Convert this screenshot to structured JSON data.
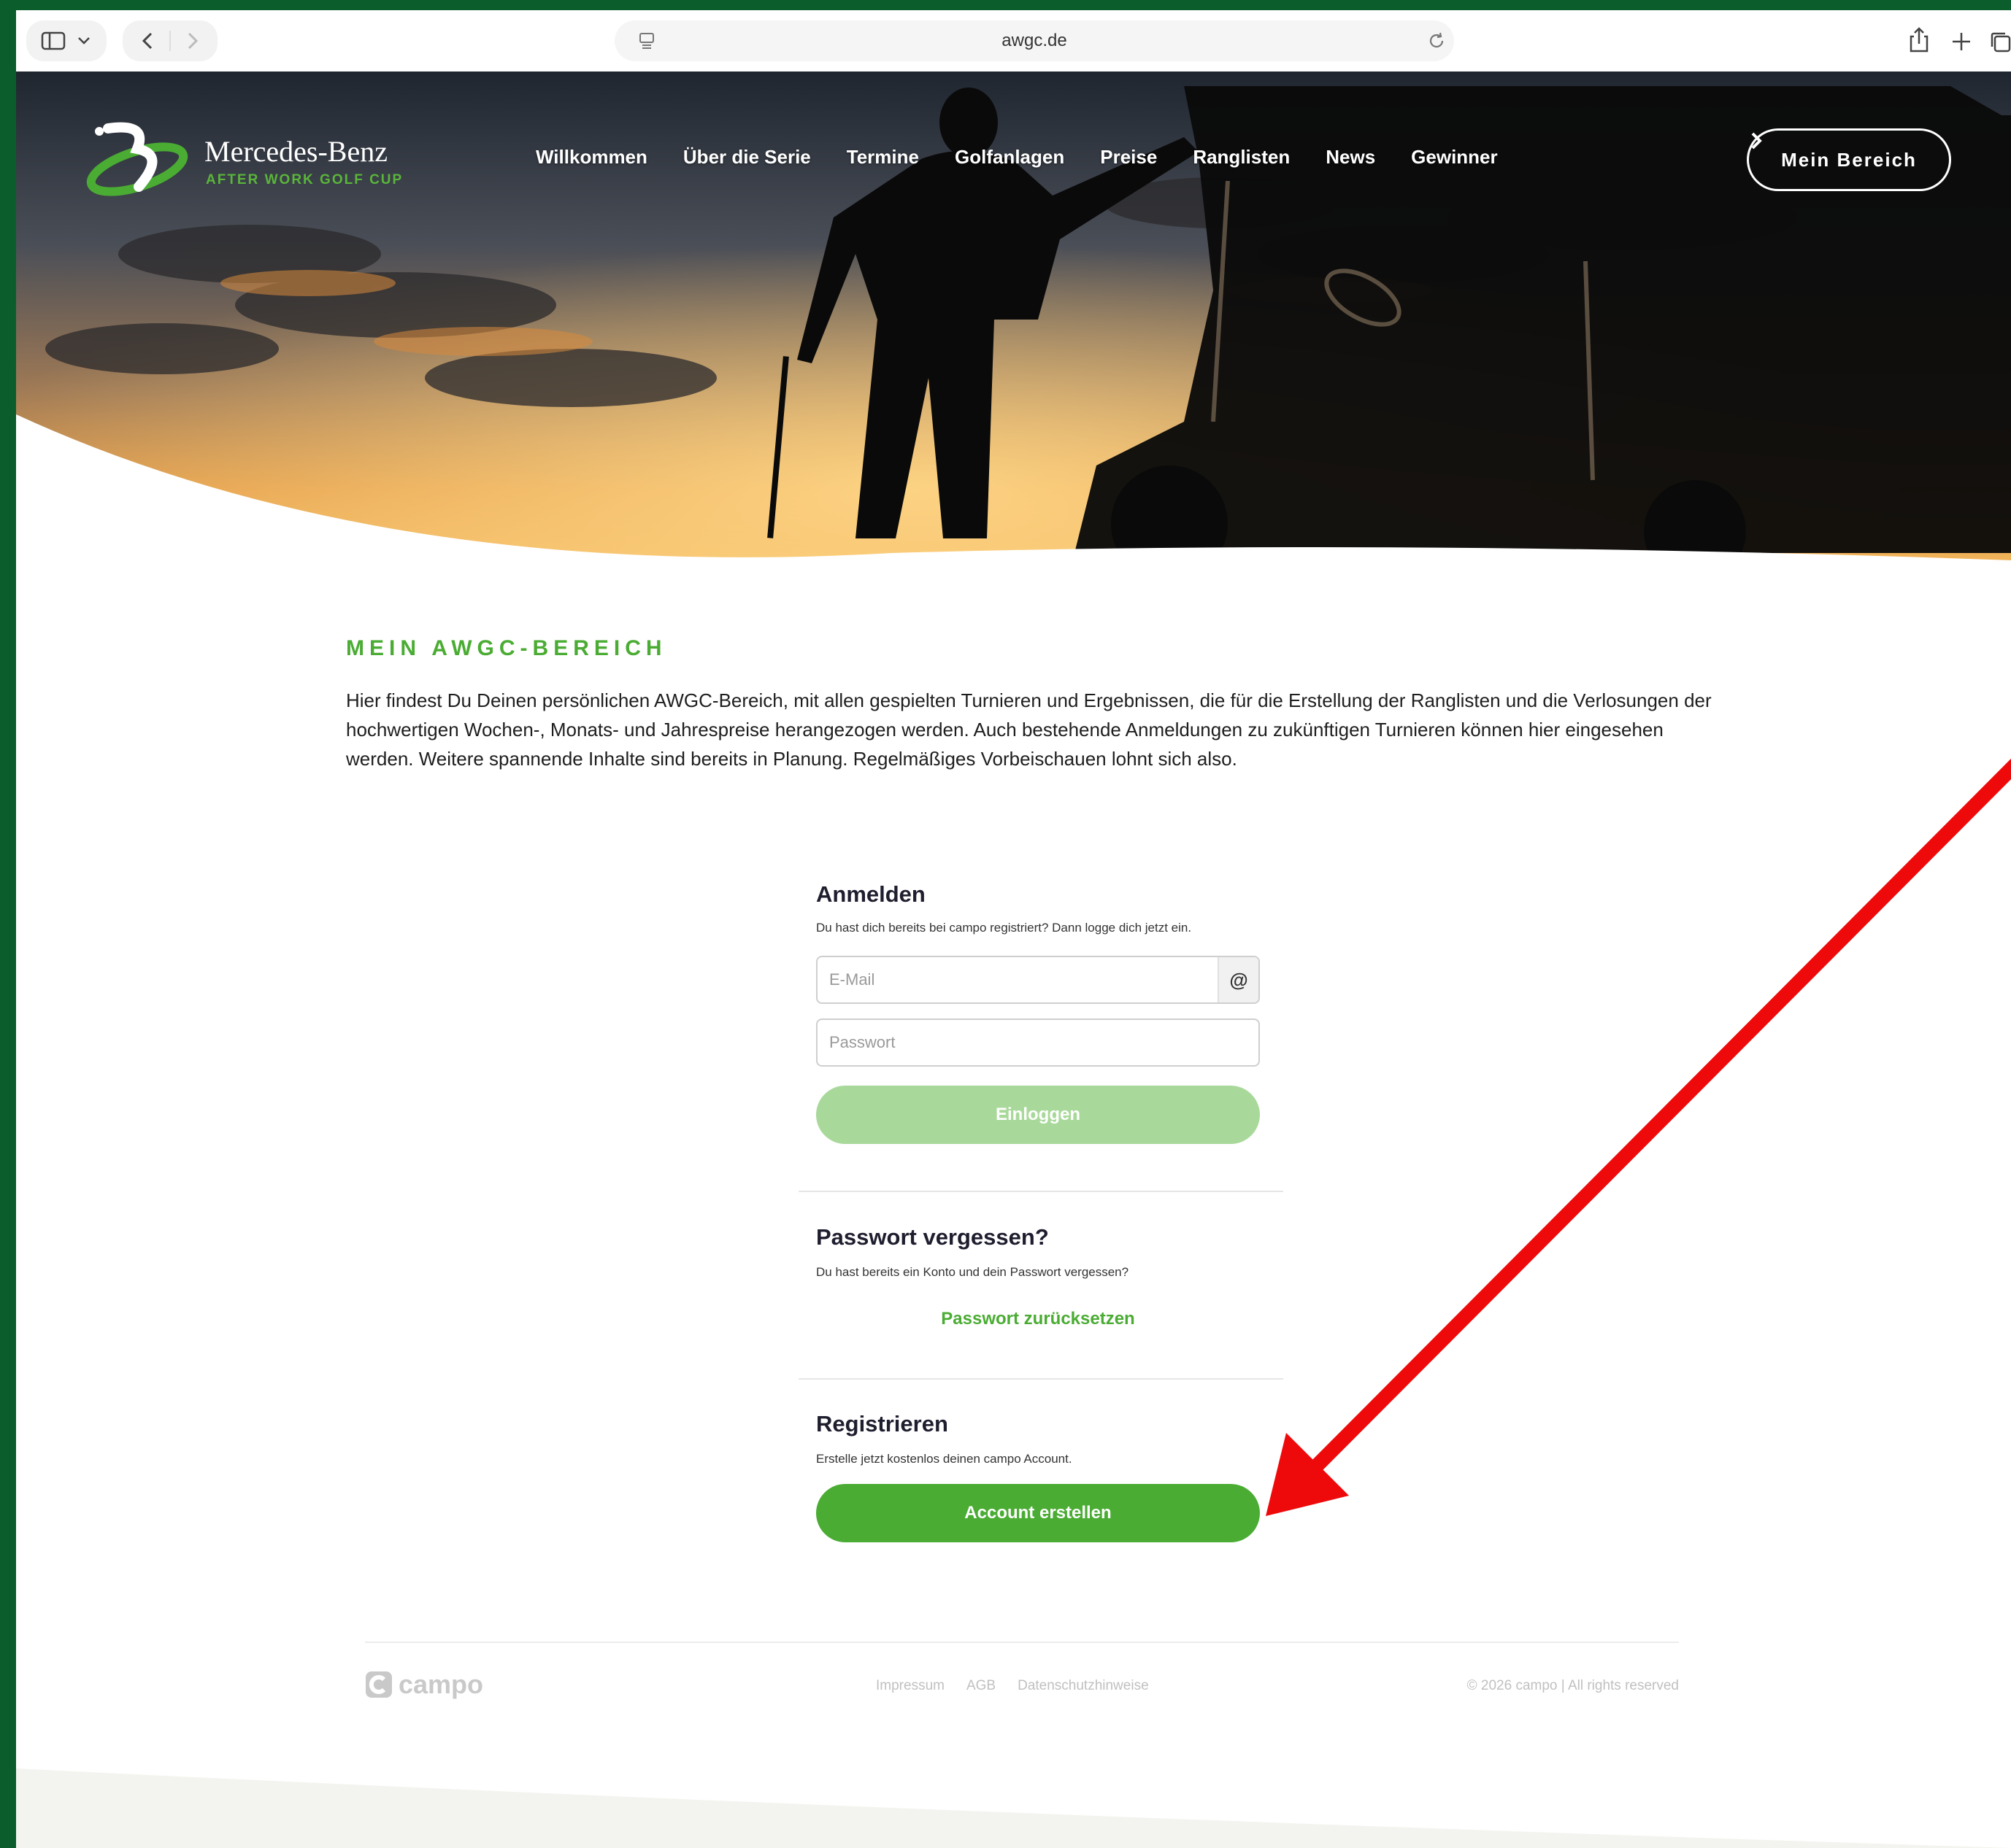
{
  "browser": {
    "url": "awgc.de"
  },
  "header": {
    "logo": {
      "title": "Mercedes-Benz",
      "subtitle": "AFTER WORK GOLF CUP"
    },
    "nav": [
      {
        "label": "Willkommen"
      },
      {
        "label": "Über die Serie"
      },
      {
        "label": "Termine"
      },
      {
        "label": "Golfanlagen"
      },
      {
        "label": "Preise"
      },
      {
        "label": "Ranglisten"
      },
      {
        "label": "News"
      },
      {
        "label": "Gewinner"
      }
    ],
    "account_button": "Mein Bereich"
  },
  "main": {
    "section_title": "MEIN AWGC-BEREICH",
    "intro": "Hier findest Du Deinen persönlichen AWGC-Bereich, mit allen gespielten Turnieren und Ergebnissen, die für die Erstellung der Ranglisten und die Verlosungen der hochwertigen Wochen-, Monats- und Jahrespreise herangezogen werden. Auch bestehende Anmeldungen zu zukünftigen Turnieren können hier eingesehen werden. Weitere spannende Inhalte sind bereits in Planung. Regelmäßiges Vorbeischauen lohnt sich also.",
    "login": {
      "title": "Anmelden",
      "subtitle": "Du hast dich bereits bei campo registriert? Dann logge dich jetzt ein.",
      "email_placeholder": "E-Mail",
      "email_icon": "@",
      "password_placeholder": "Passwort",
      "submit_label": "Einloggen"
    },
    "forgot": {
      "title": "Passwort vergessen?",
      "subtitle": "Du hast bereits ein Konto und dein Passwort vergessen?",
      "link_label": "Passwort zurücksetzen"
    },
    "register": {
      "title": "Registrieren",
      "subtitle": "Erstelle jetzt kostenlos deinen campo Account.",
      "button_label": "Account erstellen"
    }
  },
  "footer": {
    "logo_text": "campo",
    "links": [
      {
        "label": "Impressum"
      },
      {
        "label": "AGB"
      },
      {
        "label": "Datenschutzhinweise"
      }
    ],
    "copyright": "© 2026 campo | All rights reserved"
  },
  "colors": {
    "brand_green": "#4aac33",
    "button_disabled": "#a8d99a",
    "annotation_arrow": "#ee0a0a"
  }
}
